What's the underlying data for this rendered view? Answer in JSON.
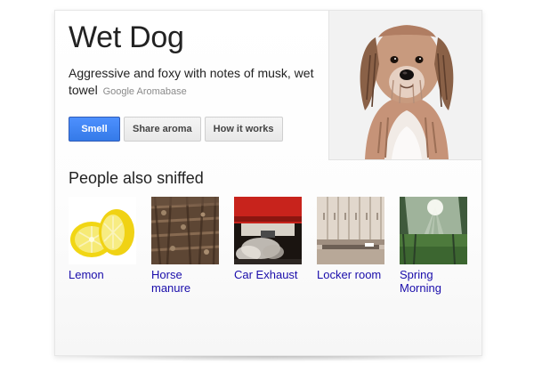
{
  "entity": {
    "title": "Wet Dog",
    "description": "Aggressive and foxy with notes of musk, wet towel",
    "source": "Google Aromabase"
  },
  "actions": {
    "smell_label": "Smell",
    "share_label": "Share aroma",
    "how_label": "How it works"
  },
  "colors": {
    "primary_button": "#4d90fe",
    "link": "#1a0dab"
  },
  "related": {
    "title": "People also sniffed",
    "items": [
      {
        "label": "Lemon"
      },
      {
        "label": "Horse manure"
      },
      {
        "label": "Car Exhaust"
      },
      {
        "label": "Locker room"
      },
      {
        "label": "Spring Morning"
      }
    ]
  }
}
